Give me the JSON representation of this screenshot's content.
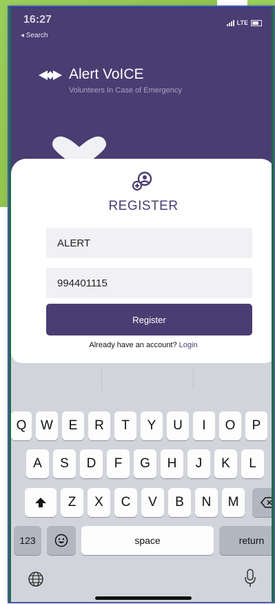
{
  "status": {
    "time": "16:27",
    "back": "◂ Search",
    "network": "LTE"
  },
  "app": {
    "title": "Alert VoICE",
    "subtitle": "Volunteers In Case of Emergency"
  },
  "register": {
    "title": "REGISTER",
    "name_value": "ALERT",
    "phone_value": "994401115",
    "button_label": "Register",
    "account_prompt": "Already have an account?",
    "login_label": "Login"
  },
  "keyboard": {
    "row1": [
      "Q",
      "W",
      "E",
      "R",
      "T",
      "Y",
      "U",
      "I",
      "O",
      "P"
    ],
    "row2": [
      "A",
      "S",
      "D",
      "F",
      "G",
      "H",
      "J",
      "K",
      "L"
    ],
    "row3": [
      "Z",
      "X",
      "C",
      "V",
      "B",
      "N",
      "M"
    ],
    "numbers_label": "123",
    "space_label": "space",
    "return_label": "return",
    "shift_icon": "shift-icon",
    "backspace_icon": "backspace-icon",
    "emoji_icon": "emoji-icon"
  },
  "colors": {
    "brand": "#4a3d72",
    "accent_green": "#8fc34b",
    "keyboard_bg": "#d2d4db"
  }
}
